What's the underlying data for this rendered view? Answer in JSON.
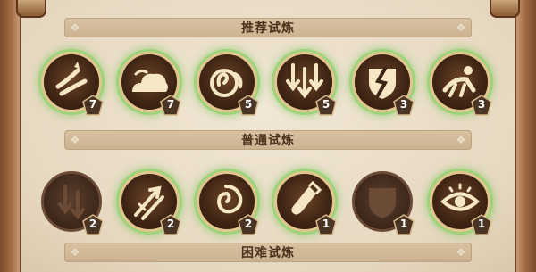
{
  "sections": [
    {
      "title": "推荐试炼",
      "trials": [
        {
          "icon": "wind-slash-icon",
          "level": "7",
          "active": true
        },
        {
          "icon": "cloud-icon",
          "level": "7",
          "active": true
        },
        {
          "icon": "swirl-icon",
          "level": "5",
          "active": true
        },
        {
          "icon": "triple-arrows-down-icon",
          "level": "5",
          "active": true
        },
        {
          "icon": "cracked-shield-icon",
          "level": "3",
          "active": true
        },
        {
          "icon": "crouching-figure-icon",
          "level": "3",
          "active": true
        }
      ]
    },
    {
      "title": "普通试炼",
      "trials": [
        {
          "icon": "arrows-down-icon",
          "level": "2",
          "active": false
        },
        {
          "icon": "double-arrow-up-icon",
          "level": "2",
          "active": true
        },
        {
          "icon": "spiral-icon",
          "level": "2",
          "active": true
        },
        {
          "icon": "potion-vial-icon",
          "level": "1",
          "active": true
        },
        {
          "icon": "shield-icon",
          "level": "1",
          "active": false
        },
        {
          "icon": "eye-icon",
          "level": "1",
          "active": true
        }
      ]
    },
    {
      "title": "困难试炼",
      "trials": []
    }
  ],
  "colors": {
    "active_glow": "#9fd37b",
    "medal_rim": "#e3c58e",
    "badge": "#4a3424",
    "banner_text": "#4b2f1a"
  }
}
